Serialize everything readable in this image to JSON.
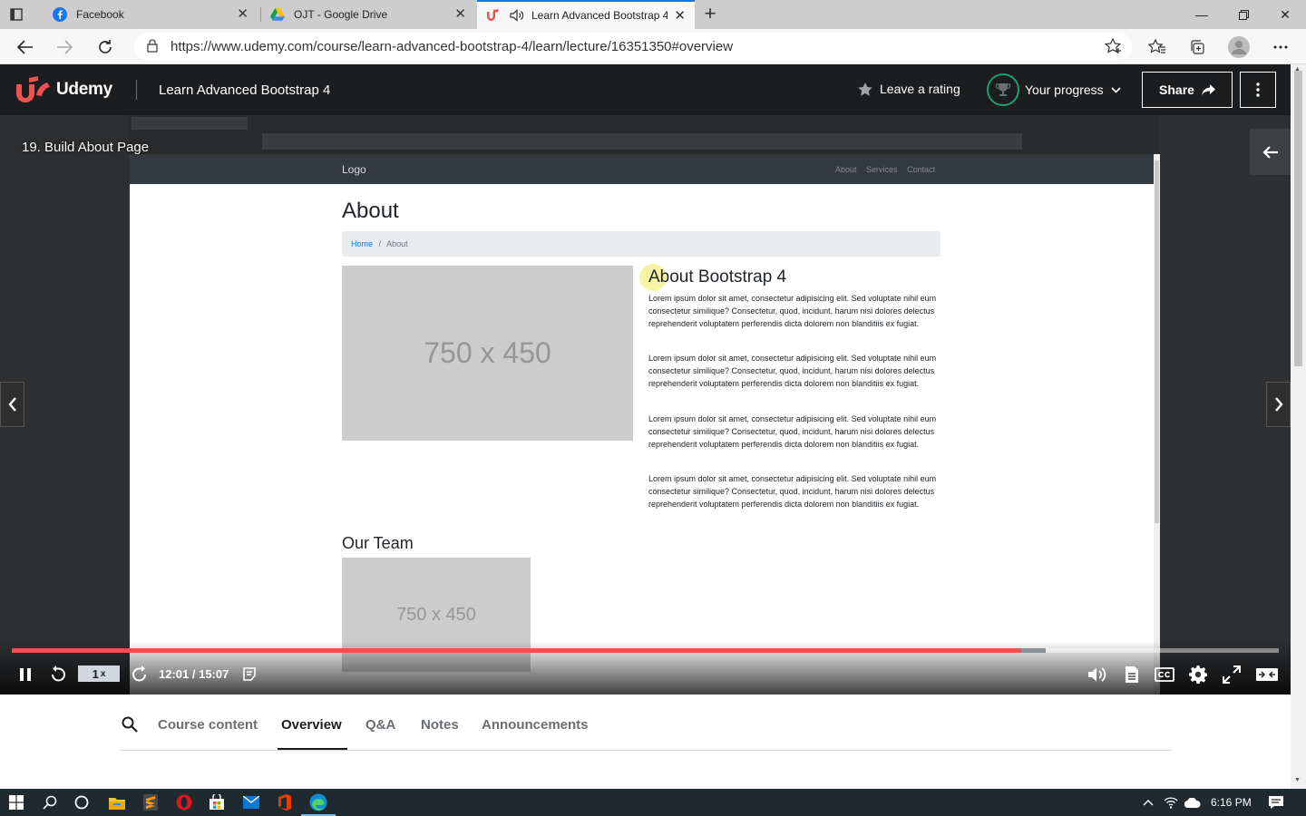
{
  "browser": {
    "tabs": [
      {
        "label": "Facebook",
        "icon": "facebook-icon"
      },
      {
        "label": "OJT - Google Drive",
        "icon": "google-drive-icon"
      },
      {
        "label": "Learn Advanced Bootstrap 4",
        "icon": "udemy-icon",
        "audio": "speaker-icon"
      }
    ],
    "url": "https://www.udemy.com/course/learn-advanced-bootstrap-4/learn/lecture/16351350#overview"
  },
  "header": {
    "brand": "Udemy",
    "course_title": "Learn Advanced Bootstrap 4",
    "rating_label": "Leave a rating",
    "progress_label": "Your progress",
    "share_label": "Share"
  },
  "player": {
    "lecture_title": "19. Build About Page",
    "playback_rate": "1",
    "playback_rate_suffix": "x",
    "time": "12:01 / 15:07",
    "progress_fraction": 0.797,
    "buffer_fraction": 0.816,
    "colors": {
      "progress": "#ec5252",
      "buffer": "#8a8f9a"
    }
  },
  "video_content": {
    "nav_logo": "Logo",
    "nav_links": [
      "About",
      "Services",
      "Contact"
    ],
    "page_heading": "About",
    "breadcrumb": {
      "home": "Home",
      "separator": "/",
      "current": "About"
    },
    "placeholder_big": "750 x 450",
    "about_heading": "About Bootstrap 4",
    "paragraphs": [
      "Lorem ipsum dolor sit amet, consectetur adipisicing elit. Sed voluptate nihil eum consectetur similique? Consectetur, quod, incidunt, harum nisi dolores delectus reprehenderit voluptatem perferendis dicta dolorem non blanditiis ex fugiat.",
      "Lorem ipsum dolor sit amet, consectetur adipisicing elit. Sed voluptate nihil eum consectetur similique? Consectetur, quod, incidunt, harum nisi dolores delectus reprehenderit voluptatem perferendis dicta dolorem non blanditiis ex fugiat.",
      "Lorem ipsum dolor sit amet, consectetur adipisicing elit. Sed voluptate nihil eum consectetur similique? Consectetur, quod, incidunt, harum nisi dolores delectus reprehenderit voluptatem perferendis dicta dolorem non blanditiis ex fugiat.",
      "Lorem ipsum dolor sit amet, consectetur adipisicing elit. Sed voluptate nihil eum consectetur similique? Consectetur, quod, incidunt, harum nisi dolores delectus reprehenderit voluptatem perferendis dicta dolorem non blanditiis ex fugiat."
    ],
    "team_heading": "Our Team",
    "placeholder_small": "750 x 450"
  },
  "course_tabs": [
    "Course content",
    "Overview",
    "Q&A",
    "Notes",
    "Announcements"
  ],
  "active_tab": "Overview",
  "taskbar": {
    "apps": [
      "start-icon",
      "search-icon",
      "cortana-icon",
      "file-explorer-icon",
      "sublime-text-icon",
      "opera-icon",
      "store-icon",
      "mail-icon",
      "office-icon",
      "edge-icon"
    ],
    "time": "6:16 PM"
  }
}
